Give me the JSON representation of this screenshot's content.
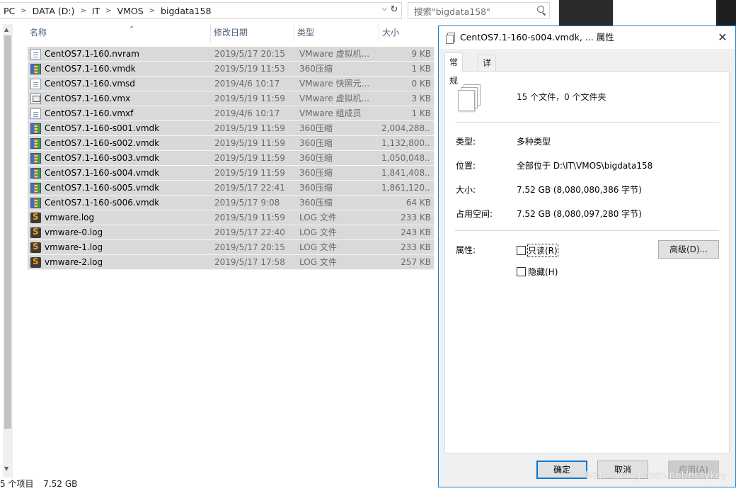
{
  "address": {
    "crumbs": [
      "PC",
      "DATA (D:)",
      "IT",
      "VMOS",
      "bigdata158"
    ],
    "search_placeholder": "搜索\"bigdata158\""
  },
  "columns": {
    "name": "名称",
    "date": "修改日期",
    "type": "类型",
    "size": "大小"
  },
  "files": [
    {
      "name": "CentOS7.1-160.nvram",
      "date": "2019/5/17 20:15",
      "type": "VMware 虚拟机...",
      "size": "9 KB",
      "icon": "document-icon"
    },
    {
      "name": "CentOS7.1-160.vmdk",
      "date": "2019/5/19 11:53",
      "type": "360压缩",
      "size": "1 KB",
      "icon": "archive-icon"
    },
    {
      "name": "CentOS7.1-160.vmsd",
      "date": "2019/4/6 10:17",
      "type": "VMware 快照元...",
      "size": "0 KB",
      "icon": "document-icon"
    },
    {
      "name": "CentOS7.1-160.vmx",
      "date": "2019/5/19 11:59",
      "type": "VMware 虚拟机...",
      "size": "3 KB",
      "icon": "vm-config-icon"
    },
    {
      "name": "CentOS7.1-160.vmxf",
      "date": "2019/4/6 10:17",
      "type": "VMware 组成员",
      "size": "1 KB",
      "icon": "document-icon"
    },
    {
      "name": "CentOS7.1-160-s001.vmdk",
      "date": "2019/5/19 11:59",
      "type": "360压缩",
      "size": "2,004,288...",
      "icon": "archive-icon"
    },
    {
      "name": "CentOS7.1-160-s002.vmdk",
      "date": "2019/5/19 11:59",
      "type": "360压缩",
      "size": "1,132,800...",
      "icon": "archive-icon"
    },
    {
      "name": "CentOS7.1-160-s003.vmdk",
      "date": "2019/5/19 11:59",
      "type": "360压缩",
      "size": "1,050,048...",
      "icon": "archive-icon"
    },
    {
      "name": "CentOS7.1-160-s004.vmdk",
      "date": "2019/5/19 11:59",
      "type": "360压缩",
      "size": "1,841,408...",
      "icon": "archive-icon"
    },
    {
      "name": "CentOS7.1-160-s005.vmdk",
      "date": "2019/5/17 22:41",
      "type": "360压缩",
      "size": "1,861,120...",
      "icon": "archive-icon"
    },
    {
      "name": "CentOS7.1-160-s006.vmdk",
      "date": "2019/5/17 9:08",
      "type": "360压缩",
      "size": "64 KB",
      "icon": "archive-icon"
    },
    {
      "name": "vmware.log",
      "date": "2019/5/19 11:59",
      "type": "LOG 文件",
      "size": "233 KB",
      "icon": "log-icon"
    },
    {
      "name": "vmware-0.log",
      "date": "2019/5/17 22:40",
      "type": "LOG 文件",
      "size": "243 KB",
      "icon": "log-icon"
    },
    {
      "name": "vmware-1.log",
      "date": "2019/5/17 20:15",
      "type": "LOG 文件",
      "size": "233 KB",
      "icon": "log-icon"
    },
    {
      "name": "vmware-2.log",
      "date": "2019/5/17 17:58",
      "type": "LOG 文件",
      "size": "257 KB",
      "icon": "log-icon"
    }
  ],
  "status": {
    "count": "5 个项目",
    "size": "7.52 GB"
  },
  "dialog": {
    "title": "CentOS7.1-160-s004.vmdk, ... 属性",
    "tabs": [
      "常规",
      "详细信息"
    ],
    "summary": "15 个文件，0 个文件夹",
    "type_label": "类型:",
    "type_value": "多种类型",
    "location_label": "位置:",
    "location_value": "全部位于 D:\\IT\\VMOS\\bigdata158",
    "size_label": "大小:",
    "size_value": "7.52 GB (8,080,080,386 字节)",
    "disk_label": "占用空间:",
    "disk_value": "7.52 GB (8,080,097,280 字节)",
    "attr_label": "属性:",
    "readonly_label": "只读(R)",
    "hidden_label": "隐藏(H)",
    "advanced_label": "高级(D)...",
    "ok_label": "确定",
    "cancel_label": "取消",
    "apply_label": "应用(A)"
  },
  "watermark": "https://blog.csdn.net/nssykey"
}
